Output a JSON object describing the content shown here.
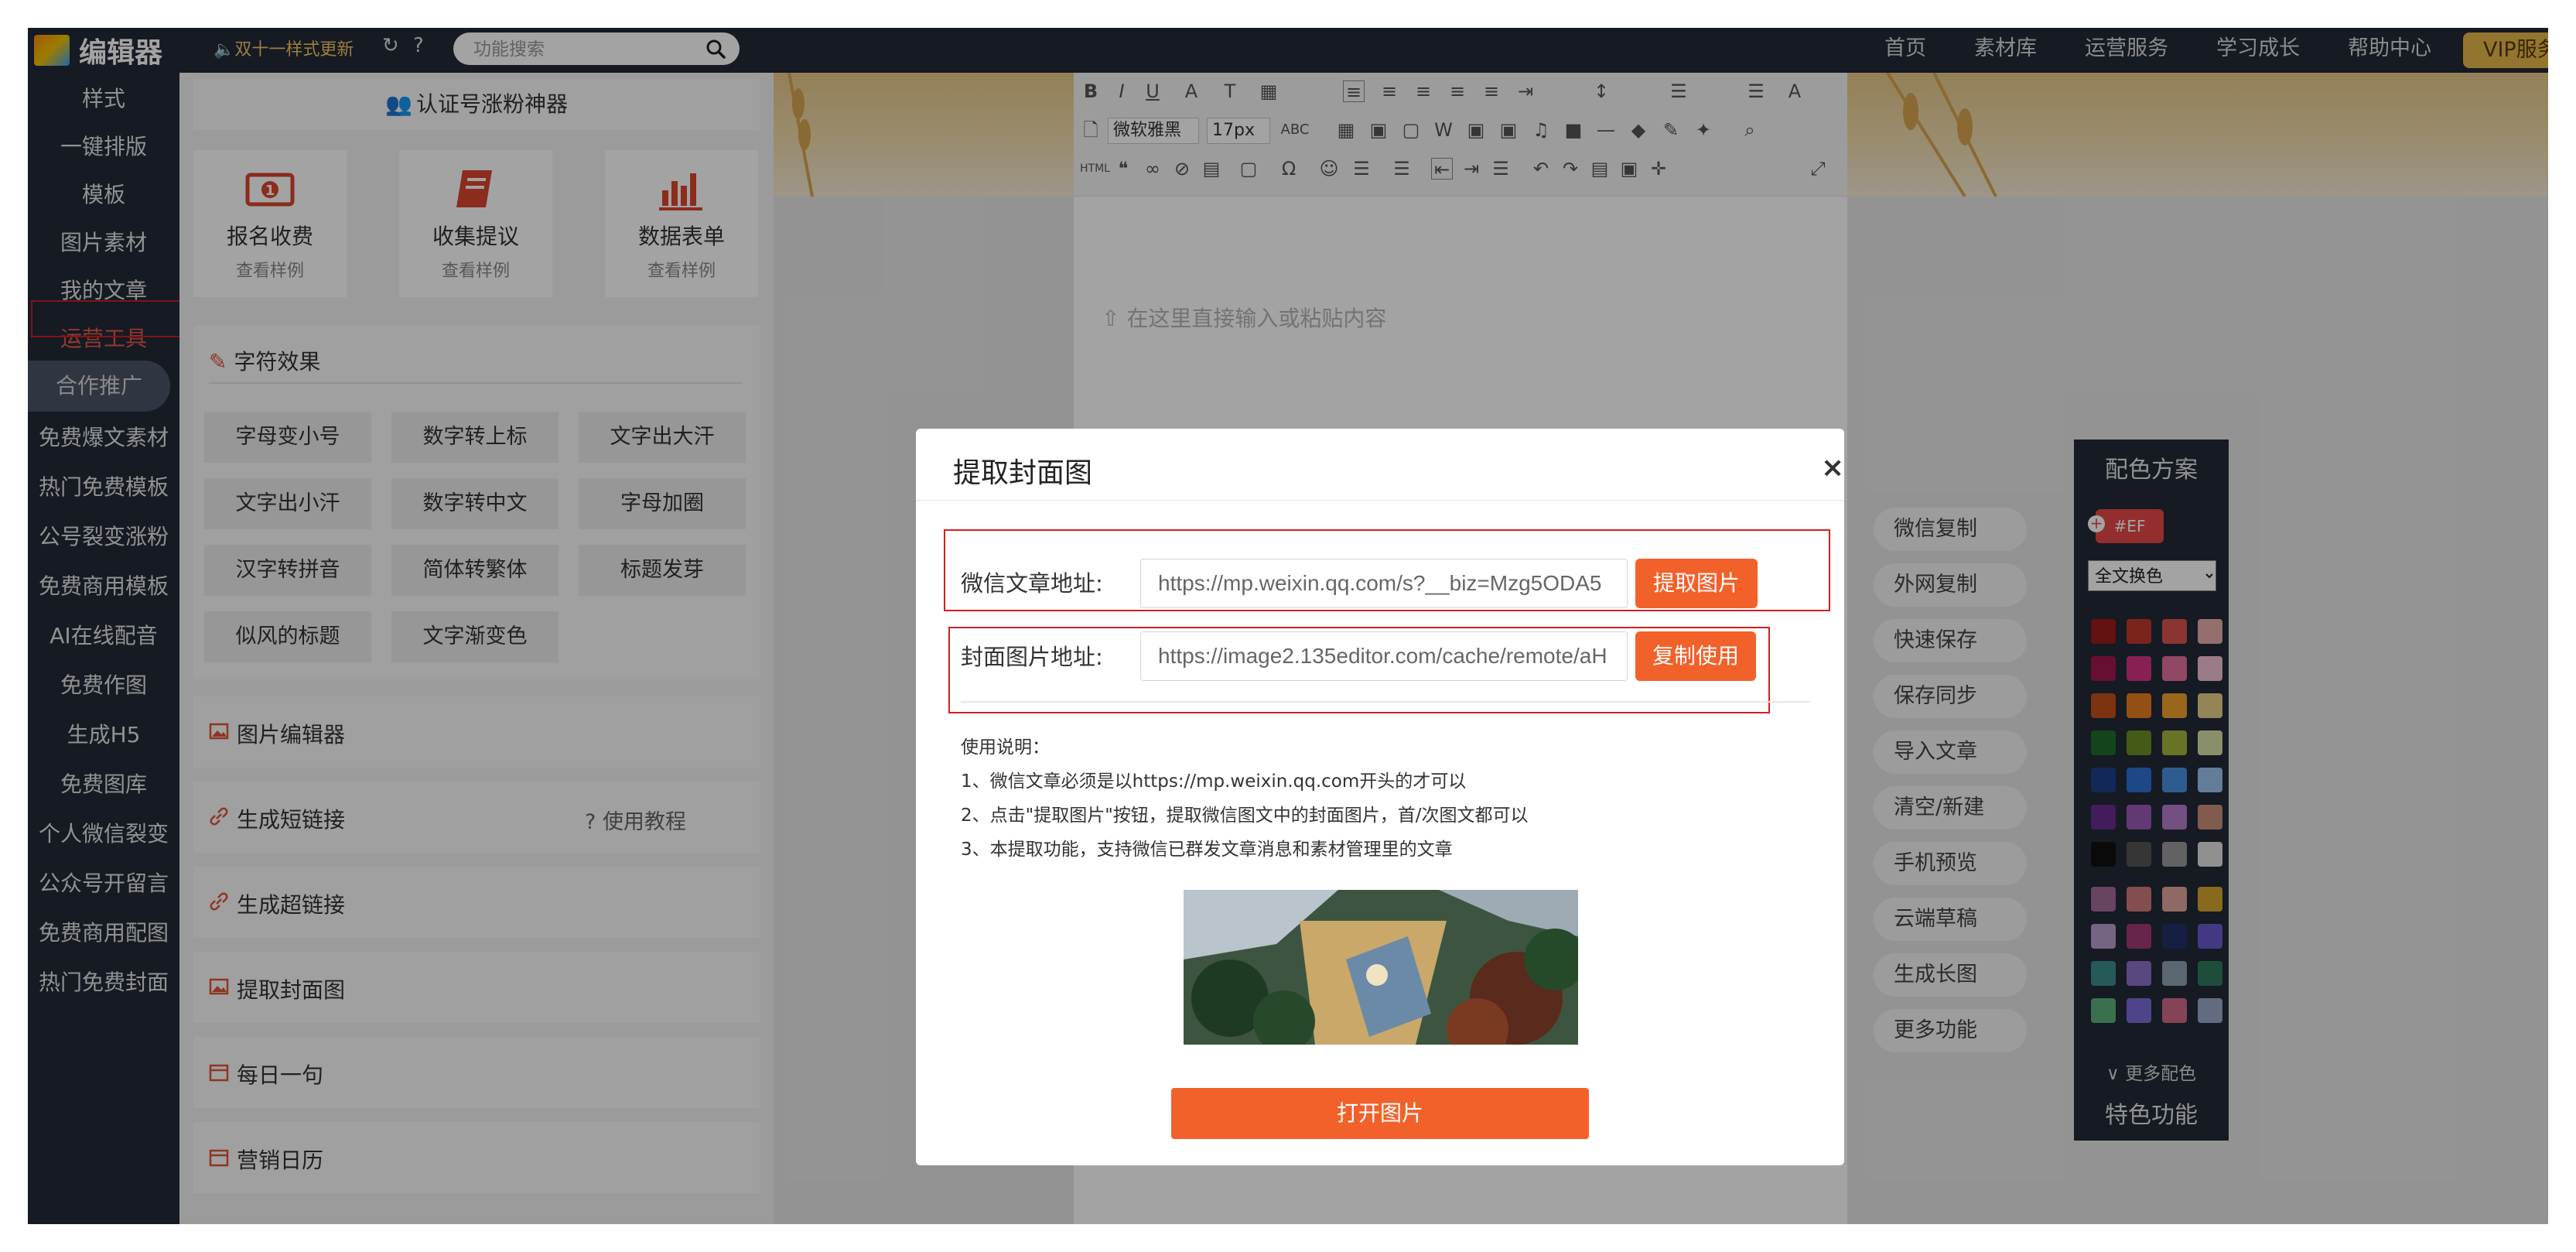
{
  "topbar": {
    "logo_text": "编辑器",
    "notice": "双十一样式更新",
    "search_placeholder": "功能搜索",
    "nav": [
      "首页",
      "素材库",
      "运营服务",
      "学习成长",
      "帮助中心"
    ],
    "vip_label": "VIP服务"
  },
  "sidebar": {
    "items": [
      "样式",
      "一键排版",
      "模板",
      "图片素材",
      "我的文章",
      "运营工具",
      "合作推广",
      "免费爆文素材",
      "热门免费模板",
      "公号裂变涨粉",
      "免费商用模板",
      "AI在线配音",
      "免费作图",
      "生成H5",
      "免费图库",
      "个人微信裂变",
      "公众号开留言",
      "免费商用配图",
      "热门免费封面"
    ],
    "highlighted": "运营工具"
  },
  "panel": {
    "promo_title": "认证号涨粉神器",
    "tiles": [
      {
        "title": "报名收费",
        "sub": "查看样例"
      },
      {
        "title": "收集提议",
        "sub": "查看样例"
      },
      {
        "title": "数据表单",
        "sub": "查看样例"
      }
    ],
    "fx_title": "字符效果",
    "fx_buttons": [
      "字母变小号",
      "数字转上标",
      "文字出大汗",
      "文字出小汗",
      "数字转中文",
      "字母加圈",
      "汉字转拼音",
      "简体转繁体",
      "标题发芽",
      "似风的标题",
      "文字渐变色"
    ],
    "tools": [
      "图片编辑器",
      "生成短链接",
      "生成超链接",
      "提取封面图",
      "每日一句",
      "营销日历"
    ],
    "tutorial_label": "使用教程"
  },
  "editor": {
    "font_family": "微软雅黑",
    "font_size": "17px",
    "placeholder": "在这里直接输入或粘贴内容"
  },
  "side_actions": [
    "微信复制",
    "外网复制",
    "快速保存",
    "保存同步",
    "导入文章",
    "清空/新建",
    "手机预览",
    "云端草稿",
    "生成长图",
    "更多功能"
  ],
  "color_panel": {
    "title": "配色方案",
    "tag": "#EF",
    "select_value": "全文换色",
    "more_label": "更多配色",
    "feature_label": "特色功能",
    "swatch_colors": [
      [
        "#9b1c1c",
        "#c0392b",
        "#d9534f",
        "#e6b0aa"
      ],
      [
        "#a3174f",
        "#d63384",
        "#e56f9e",
        "#f1c0d4"
      ],
      [
        "#c0501a",
        "#e67e22",
        "#f0a02b",
        "#e6d08a"
      ],
      [
        "#1e6b2a",
        "#6b8e23",
        "#a4b53a",
        "#d8e0a8"
      ],
      [
        "#1d3f8a",
        "#2e6fd0",
        "#4a90e2",
        "#9cc3ec"
      ],
      [
        "#6a2c91",
        "#9b59b6",
        "#b47ccc",
        "#c98f7a"
      ],
      [
        "#111111",
        "#555555",
        "#9a9a9a",
        "#e2e2e2"
      ],
      [
        "#a46a9a",
        "#d07a7a",
        "#e2a59a",
        "#d4a72c"
      ],
      [
        "#b89fd0",
        "#a23a78",
        "#23306b",
        "#6a5acd"
      ],
      [
        "#3c8d8d",
        "#8c6fc8",
        "#8ea0b0",
        "#2f7a5a"
      ],
      [
        "#5bb07a",
        "#7a6bd8",
        "#d06a8a",
        "#9aa8c8"
      ]
    ]
  },
  "modal": {
    "title": "提取封面图",
    "close": "×",
    "article_label": "微信文章地址:",
    "article_value": "https://mp.weixin.qq.com/s?__biz=Mzg5ODA5",
    "extract_button": "提取图片",
    "cover_label": "封面图片地址:",
    "cover_value": "https://image2.135editor.com/cache/remote/aH",
    "copy_button": "复制使用",
    "usage_title": "使用说明：",
    "usage_lines": [
      "1、微信文章必须是以https://mp.weixin.qq.com开头的才可以",
      "2、点击\"提取图片\"按钮，提取微信图文中的封面图片，首/次图文都可以",
      "3、本提取功能，支持微信已群发文章消息和素材管理里的文章"
    ],
    "open_button": "打开图片"
  },
  "colors": {
    "accent": "#f2612a",
    "dark_bg": "#222a38",
    "highlight_box": "#d21f1f"
  }
}
